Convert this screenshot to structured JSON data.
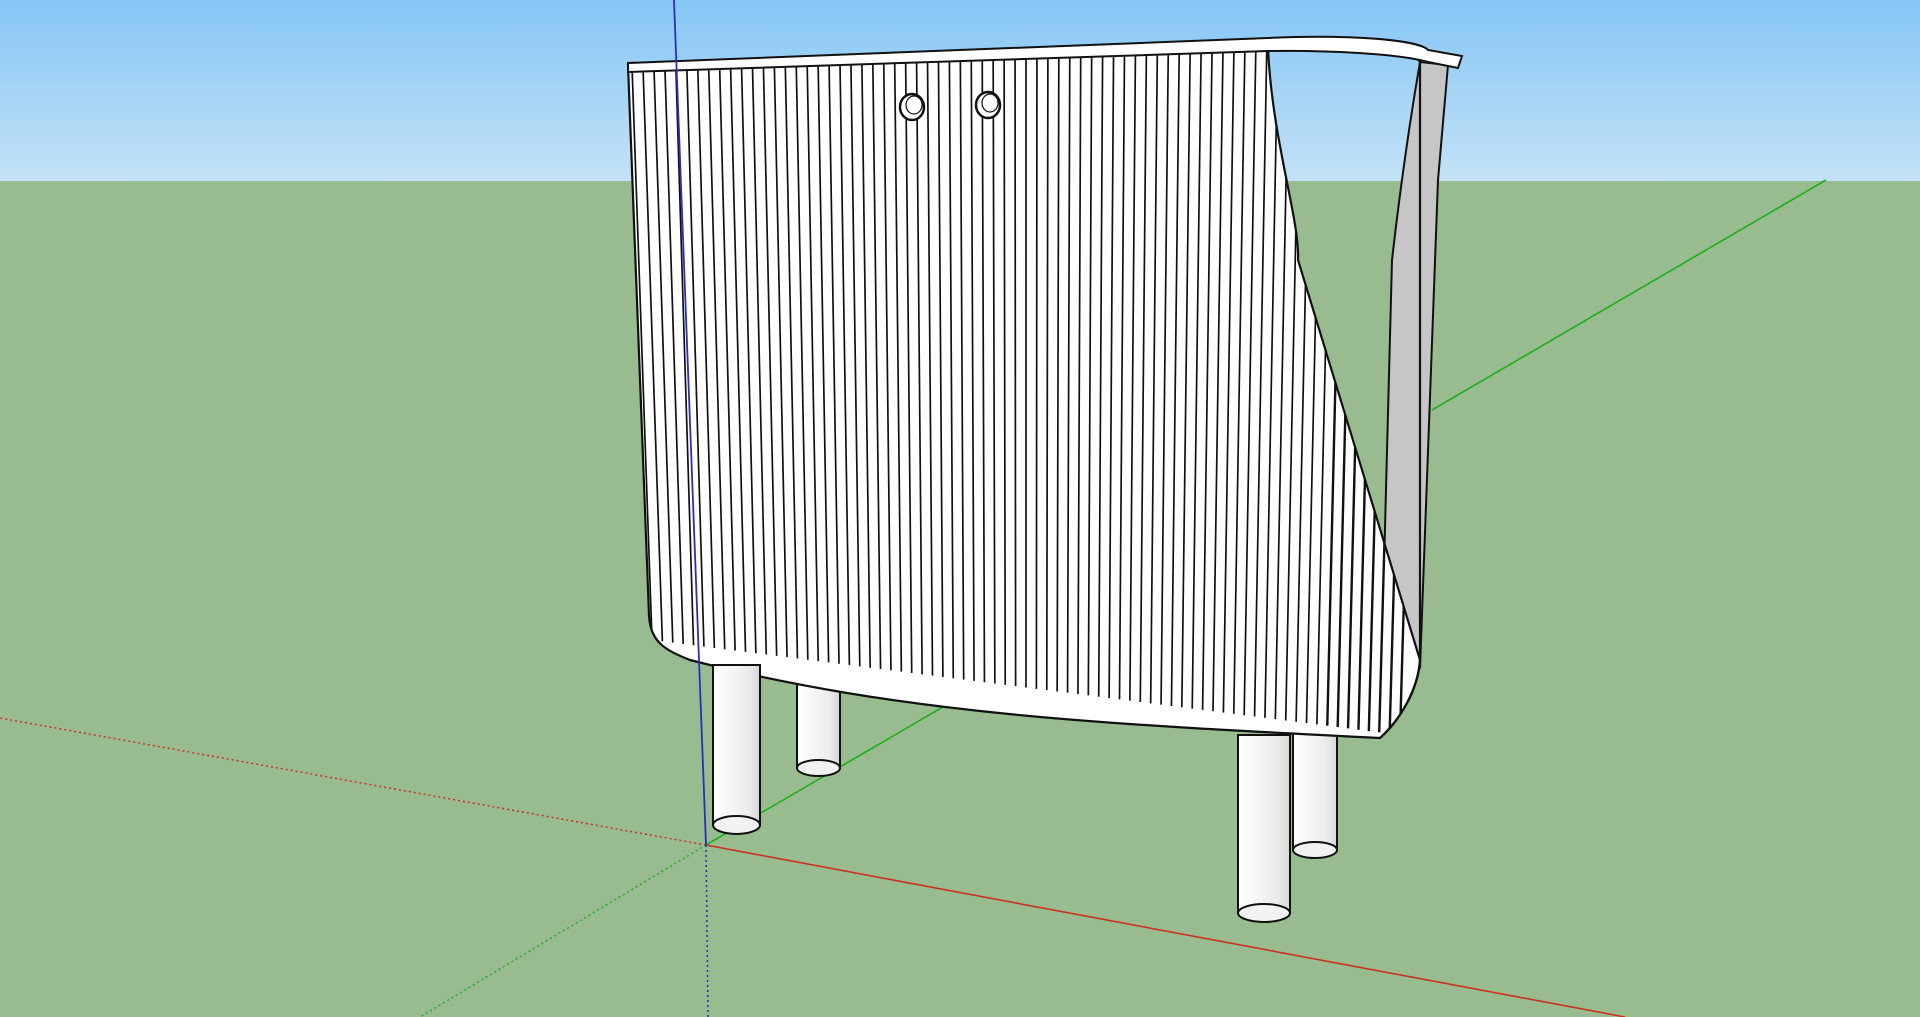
{
  "scene": {
    "sky_top_color": "#85c6f6",
    "sky_bottom_color": "#c4e2f6",
    "ground_color": "#99bb90",
    "red_axis_color": "#c8331f",
    "green_axis_color": "#1fae1f",
    "blue_axis_color": "#2d2db7",
    "model_face_color": "#ffffff",
    "model_side_color": "#c6c6c6",
    "edge_color": "#111111",
    "model": {
      "name": "fluted-cabinet",
      "flute_count": 72,
      "leg_count": 4,
      "door_knob_count": 2
    }
  }
}
